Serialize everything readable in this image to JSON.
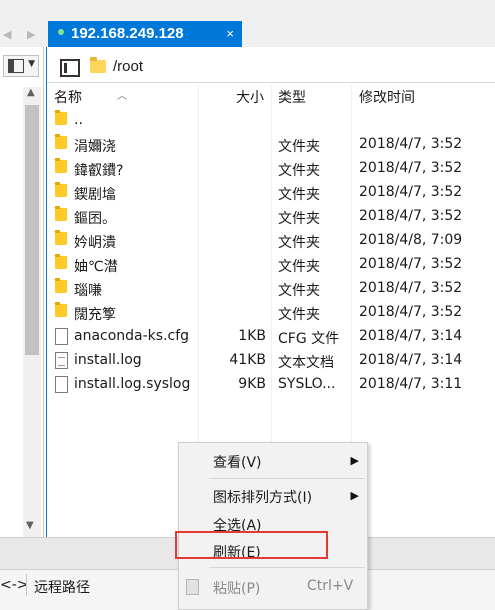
{
  "tab": {
    "title": "192.168.249.128",
    "close": "×"
  },
  "tab_nav": "◀ ▶",
  "path": "/root",
  "columns": {
    "name": "名称",
    "size": "大小",
    "type": "类型",
    "time": "修改时间"
  },
  "files": [
    {
      "name": "..",
      "size": "",
      "type": "",
      "time": "",
      "kind": "folder"
    },
    {
      "name": "涓嬭浇",
      "size": "",
      "type": "文件夹",
      "time": "2018/4/7, 3:52",
      "kind": "folder"
    },
    {
      "name": "鍏叡鐨?",
      "size": "",
      "type": "文件夹",
      "time": "2018/4/7, 3:52",
      "kind": "folder"
    },
    {
      "name": "鍥剧墖",
      "size": "",
      "type": "文件夹",
      "time": "2018/4/7, 3:52",
      "kind": "folder"
    },
    {
      "name": "鏂囨。",
      "size": "",
      "type": "文件夹",
      "time": "2018/4/7, 3:52",
      "kind": "folder"
    },
    {
      "name": "妗岄潰",
      "size": "",
      "type": "文件夹",
      "time": "2018/4/8, 7:09",
      "kind": "folder"
    },
    {
      "name": "妯℃澘",
      "size": "",
      "type": "文件夹",
      "time": "2018/4/7, 3:52",
      "kind": "folder"
    },
    {
      "name": "瑙嗛",
      "size": "",
      "type": "文件夹",
      "time": "2018/4/7, 3:52",
      "kind": "folder"
    },
    {
      "name": "闊充箰",
      "size": "",
      "type": "文件夹",
      "time": "2018/4/7, 3:52",
      "kind": "folder"
    },
    {
      "name": "anaconda-ks.cfg",
      "size": "1KB",
      "type": "CFG 文件",
      "time": "2018/4/7, 3:14",
      "kind": "file"
    },
    {
      "name": "install.log",
      "size": "41KB",
      "type": "文本文档",
      "time": "2018/4/7, 3:14",
      "kind": "text"
    },
    {
      "name": "install.log.syslog",
      "size": "9KB",
      "type": "SYSLO...",
      "time": "2018/4/7, 3:11",
      "kind": "file"
    }
  ],
  "context_menu": {
    "view": "查看(V)",
    "arrange": "图标排列方式(I)",
    "select_all": "全选(A)",
    "refresh": "刷新(E)",
    "paste": "粘贴(P)",
    "paste_shortcut": "Ctrl+V"
  },
  "status": {
    "left": "<->",
    "remote_path": "远程路径"
  },
  "colors": {
    "accent": "#0078d7",
    "folder": "#ffca28",
    "highlight": "#e53935"
  }
}
